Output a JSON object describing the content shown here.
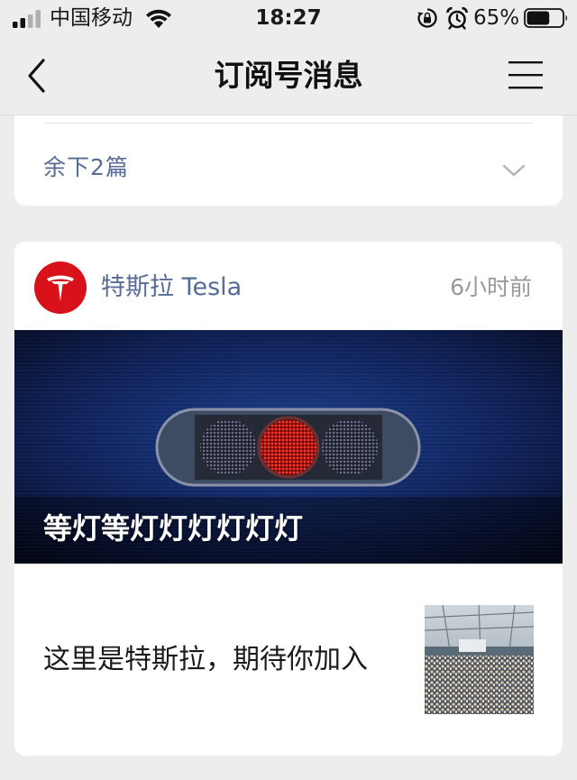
{
  "status_bar": {
    "carrier": "中国移动",
    "time": "18:27",
    "battery_percent": "65%",
    "battery_level": 0.65
  },
  "nav": {
    "title": "订阅号消息"
  },
  "collapsed_group": {
    "more_label": "余下2篇"
  },
  "account_card": {
    "account_name": "特斯拉 Tesla",
    "time_ago": "6小时前",
    "brand_color": "#d8111b",
    "main_article": {
      "title": "等灯等灯灯灯灯灯灯"
    },
    "sub_article": {
      "title": "这里是特斯拉，期待你加入"
    }
  },
  "colors": {
    "link_blue": "#576b95",
    "background": "#ededed",
    "card": "#ffffff",
    "muted_text": "#9a9a9a"
  }
}
